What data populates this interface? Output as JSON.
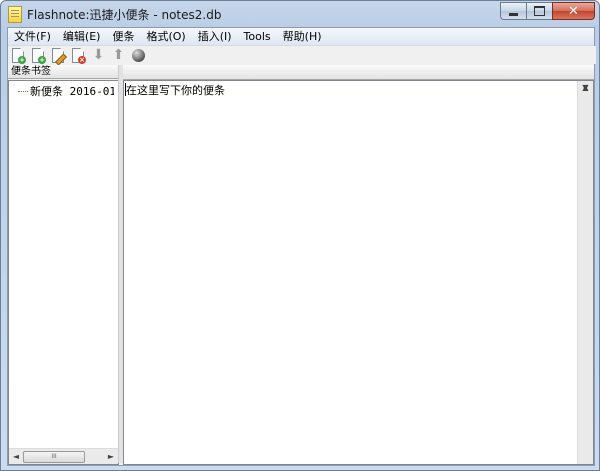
{
  "window": {
    "title": "Flashnote:迅捷小便条 - notes2.db",
    "buttons": {
      "close_label": "✕"
    }
  },
  "menu": {
    "items": [
      "文件(F)",
      "编辑(E)",
      "便条",
      "格式(O)",
      "插入(I)",
      "Tools",
      "帮助(H)"
    ]
  },
  "toolbar": {
    "icons": [
      "new-note-icon",
      "new-child-note-icon",
      "edit-note-icon",
      "delete-note-icon",
      "move-down-icon",
      "move-up-icon",
      "globe-icon"
    ]
  },
  "sidebar": {
    "header": "便条书签",
    "items": [
      {
        "label": "新便条 2016-01-"
      }
    ]
  },
  "editor": {
    "text": "在这里写下你的便条"
  },
  "scrollbar": {
    "thumb_grip": "III",
    "left_arrow": "◄",
    "right_arrow": "►",
    "up_arrow": "▲",
    "down_arrow": "▼"
  },
  "colors": {
    "frame": "#b9cde5",
    "close_button": "#c2452c",
    "add_badge": "#37a33a",
    "delete_badge": "#d63a2a"
  }
}
